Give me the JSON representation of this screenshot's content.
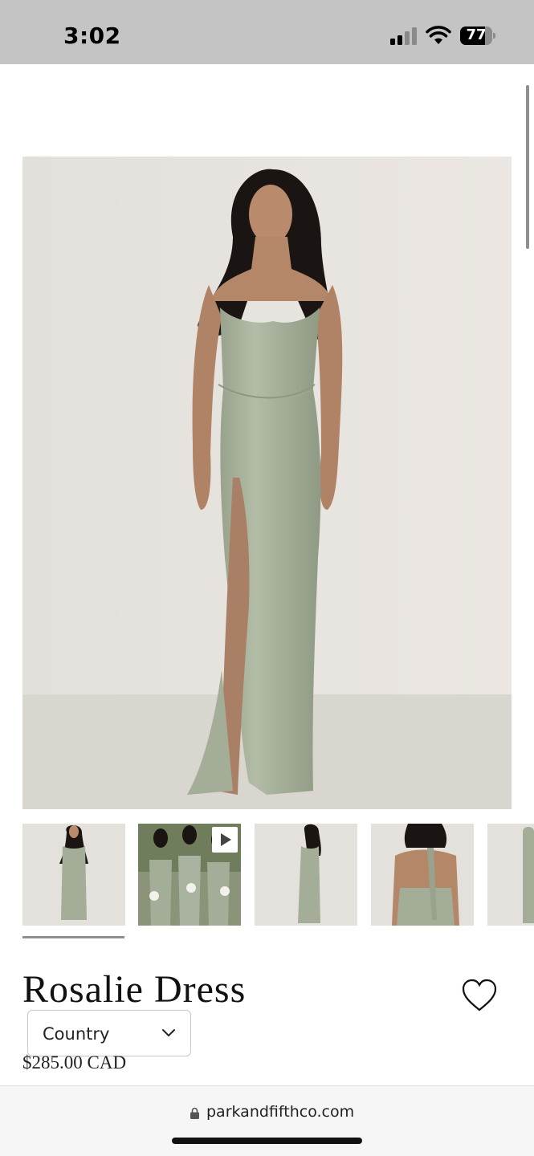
{
  "status_bar": {
    "time": "3:02",
    "battery_level": "77",
    "battery_fraction": 0.77,
    "signal_bars_active": 2,
    "signal_bars_total": 4,
    "icons": [
      "signal-icon",
      "wifi-icon",
      "battery-icon"
    ]
  },
  "product": {
    "title": "Rosalie Dress",
    "price": "$285.00 CAD",
    "main_image_alt": "model-in-sage-satin-dress",
    "thumbnails": [
      {
        "name": "thumbnail-front",
        "selected": true,
        "video": false
      },
      {
        "name": "thumbnail-bridesmaids-group",
        "selected": false,
        "video": true
      },
      {
        "name": "thumbnail-side",
        "selected": false,
        "video": false
      },
      {
        "name": "thumbnail-back",
        "selected": false,
        "video": false
      },
      {
        "name": "thumbnail-partial",
        "selected": false,
        "video": false
      }
    ]
  },
  "country_selector": {
    "label": "Country",
    "icon": "chevron-down-icon"
  },
  "browser": {
    "url": "parkandfifthco.com",
    "icon": "lock-icon"
  },
  "colors": {
    "status_bar_bg": "#c4c4c4",
    "dress_sage": "#a8b29c",
    "photo_bg": "#e5e2de",
    "browser_bar_bg": "#f6f6f6"
  }
}
